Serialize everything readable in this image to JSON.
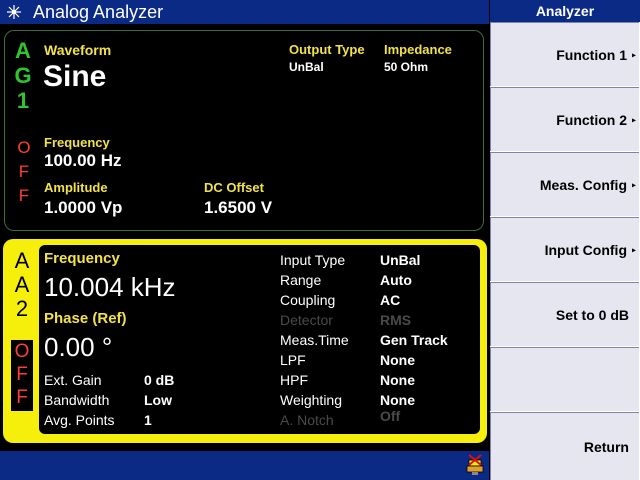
{
  "app": {
    "title": "Analog Analyzer"
  },
  "softkeys": {
    "header": "Analyzer",
    "items": [
      "Function 1",
      "Function 2",
      "Meas. Config",
      "Input Config",
      "Set to 0 dB",
      "",
      "Return"
    ],
    "arrow": "▸"
  },
  "generator": {
    "channel_letters": [
      "A",
      "G",
      "1"
    ],
    "off_letters": [
      "O",
      "F",
      "F"
    ],
    "waveform_label": "Waveform",
    "waveform_value": "Sine",
    "output_type_label": "Output Type",
    "output_type_value": "UnBal",
    "impedance_label": "Impedance",
    "impedance_value": "50 Ohm",
    "frequency_label": "Frequency",
    "frequency_value": "100.00 Hz",
    "amplitude_label": "Amplitude",
    "amplitude_value": "1.0000 Vp",
    "dc_offset_label": "DC Offset",
    "dc_offset_value": "1.6500 V"
  },
  "analyzer": {
    "channel_letters": [
      "A",
      "A",
      "2"
    ],
    "off_letters": [
      "O",
      "F",
      "F"
    ],
    "frequency_label": "Frequency",
    "frequency_value": "10.004 kHz",
    "phase_label": "Phase (Ref)",
    "phase_value": "0.00 °",
    "left_settings": [
      {
        "label": "Ext. Gain",
        "value": "0 dB"
      },
      {
        "label": "Bandwidth",
        "value": "Low"
      },
      {
        "label": "Avg. Points",
        "value": "1"
      }
    ],
    "right_settings": [
      {
        "label": "Input Type",
        "value": "UnBal",
        "enabled": true
      },
      {
        "label": "Range",
        "value": "Auto",
        "enabled": true
      },
      {
        "label": "Coupling",
        "value": "AC",
        "enabled": true
      },
      {
        "label": "Detector",
        "value": "RMS",
        "enabled": false
      },
      {
        "label": "Meas.Time",
        "value": "Gen Track",
        "enabled": true
      },
      {
        "label": "LPF",
        "value": "None",
        "enabled": true
      },
      {
        "label": "HPF",
        "value": "None",
        "enabled": true
      },
      {
        "label": "Weighting",
        "value": "None",
        "enabled": true
      },
      {
        "label": "A. Notch",
        "value": "Off",
        "enabled": false
      }
    ]
  },
  "colors": {
    "title_bar": "#0b2a86",
    "channel_green": "#2fc52f",
    "off_red": "#ff3d3d",
    "label_yellow": "#f2e24a",
    "analyzer_border": "#f5ef0b"
  },
  "icons": {
    "logo": "starburst-logo-icon",
    "status": "usb-disconnected-icon"
  }
}
